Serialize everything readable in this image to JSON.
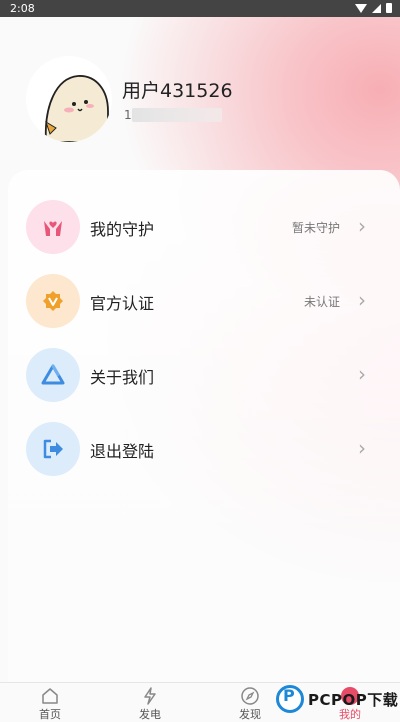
{
  "status_bar": {
    "time": "2:08"
  },
  "profile": {
    "username": "用户431526",
    "user_id_visible": "1"
  },
  "menu": [
    {
      "label": "我的守护",
      "status": "暂未守护",
      "icon": "guard-icon",
      "color": "#fde0ea"
    },
    {
      "label": "官方认证",
      "status": "未认证",
      "icon": "verified-badge-icon",
      "color": "#fde7cf"
    },
    {
      "label": "关于我们",
      "status": "",
      "icon": "about-icon",
      "color": "#dcecfb"
    },
    {
      "label": "退出登陆",
      "status": "",
      "icon": "logout-icon",
      "color": "#dcecfb"
    }
  ],
  "tabs": [
    {
      "label": "首页",
      "icon": "home-icon"
    },
    {
      "label": "发电",
      "icon": "lightning-icon"
    },
    {
      "label": "发现",
      "icon": "compass-icon"
    },
    {
      "label": "我的",
      "icon": "profile-icon"
    }
  ],
  "watermark": {
    "text": "PCPOP下载",
    "letter": "P"
  },
  "colors": {
    "accent": "#e84b67",
    "header_pink": "#f7aeb4",
    "watermark_blue": "#1e88d8"
  }
}
